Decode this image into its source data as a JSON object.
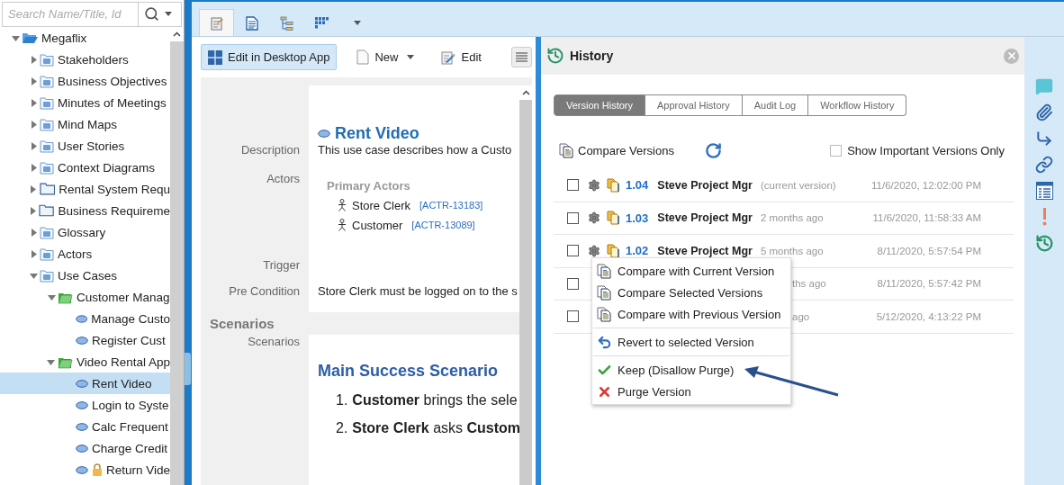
{
  "search": {
    "placeholder": "Search Name/Title, Id"
  },
  "tree": [
    {
      "label": "Megaflix",
      "kind": "root",
      "expanded": true,
      "selected": false,
      "locked": false,
      "children": [
        {
          "label": "Stakeholders",
          "kind": "module",
          "expanded": false,
          "selected": false,
          "locked": false
        },
        {
          "label": "Business Objectives",
          "kind": "module",
          "expanded": false,
          "selected": false,
          "locked": false
        },
        {
          "label": "Minutes of Meetings",
          "kind": "module",
          "expanded": false,
          "selected": false,
          "locked": false
        },
        {
          "label": "Mind Maps",
          "kind": "module",
          "expanded": false,
          "selected": false,
          "locked": false
        },
        {
          "label": "User Stories",
          "kind": "module",
          "expanded": false,
          "selected": false,
          "locked": false
        },
        {
          "label": "Context Diagrams",
          "kind": "module",
          "expanded": false,
          "selected": false,
          "locked": false
        },
        {
          "label": "Rental System Requ",
          "kind": "folder",
          "expanded": false,
          "selected": false,
          "locked": false
        },
        {
          "label": "Business Requireme",
          "kind": "folder",
          "expanded": false,
          "selected": false,
          "locked": false
        },
        {
          "label": "Glossary",
          "kind": "module",
          "expanded": false,
          "selected": false,
          "locked": false
        },
        {
          "label": "Actors",
          "kind": "module",
          "expanded": false,
          "selected": false,
          "locked": false
        },
        {
          "label": "Use Cases",
          "kind": "module",
          "expanded": true,
          "selected": false,
          "locked": false,
          "children": [
            {
              "label": "Customer Manag",
              "kind": "group",
              "expanded": true,
              "selected": false,
              "locked": false,
              "children": [
                {
                  "label": "Manage Custo",
                  "kind": "use-case",
                  "selected": false,
                  "locked": false
                },
                {
                  "label": "Register Cust",
                  "kind": "use-case",
                  "selected": false,
                  "locked": false
                }
              ]
            },
            {
              "label": "Video Rental App",
              "kind": "group",
              "expanded": true,
              "selected": false,
              "locked": false,
              "children": [
                {
                  "label": "Rent Video",
                  "kind": "use-case",
                  "selected": true,
                  "locked": false
                },
                {
                  "label": "Login to Syste",
                  "kind": "use-case",
                  "selected": false,
                  "locked": false
                },
                {
                  "label": "Calc Frequent",
                  "kind": "use-case",
                  "selected": false,
                  "locked": false
                },
                {
                  "label": "Charge Credit",
                  "kind": "use-case",
                  "selected": false,
                  "locked": false
                },
                {
                  "label": "Return Vide",
                  "kind": "use-case",
                  "selected": false,
                  "locked": true
                }
              ]
            }
          ]
        }
      ]
    }
  ],
  "view_tabs": [
    {
      "kind": "details",
      "selected": true
    },
    {
      "kind": "document",
      "selected": false
    },
    {
      "kind": "tree",
      "selected": false
    },
    {
      "kind": "grid",
      "selected": false
    }
  ],
  "toolbar": [
    {
      "label": "Edit in Desktop App",
      "kind": "desktop",
      "selected": true
    },
    {
      "label": "New",
      "kind": "new",
      "selected": false
    },
    {
      "label": "Edit",
      "kind": "edit",
      "selected": false
    }
  ],
  "item": {
    "title": "Rent Video",
    "fields": [
      {
        "label": "Description",
        "kind": "text",
        "value": "This use case describes how a Custo"
      },
      {
        "label": "Actors",
        "kind": "actors",
        "heading": "Primary Actors",
        "actors": [
          {
            "name": "Store Clerk",
            "id": "[ACTR-13183]"
          },
          {
            "name": "Customer",
            "id": "[ACTR-13089]"
          }
        ]
      },
      {
        "label": "Trigger",
        "kind": "empty"
      },
      {
        "label": "Pre Condition",
        "kind": "text",
        "value": "Store Clerk must be logged on to the s"
      }
    ],
    "section": "Scenarios",
    "scenarios": {
      "label": "Scenarios",
      "heading": "Main Success Scenario",
      "steps": [
        {
          "number": "1.",
          "text": "**Customer** brings the sele"
        },
        {
          "number": "2.",
          "text": "**Store Clerk** asks **Custom**"
        }
      ]
    }
  },
  "history": {
    "title": "History",
    "tabs": [
      {
        "label": "Version History",
        "selected": true
      },
      {
        "label": "Approval History",
        "selected": false
      },
      {
        "label": "Audit Log",
        "selected": false
      },
      {
        "label": "Workflow History",
        "selected": false
      }
    ],
    "compare_label": "Compare Versions",
    "important_only": {
      "label": "Show Important Versions Only",
      "checked": false
    },
    "versions": [
      {
        "covered": false,
        "checked": false,
        "version": "1.04",
        "author": "Steve Project Mgr",
        "note": "(current version)",
        "date": "11/6/2020, 12:02:00 PM"
      },
      {
        "covered": false,
        "checked": false,
        "version": "1.03",
        "author": "Steve Project Mgr",
        "note": "2 months ago",
        "date": "11/6/2020, 11:58:33 AM"
      },
      {
        "covered": false,
        "checked": false,
        "version": "1.02",
        "author": "Steve Project Mgr",
        "note": "5 months ago",
        "date": "8/11/2020, 5:57:54 PM"
      },
      {
        "covered": true,
        "checked": false,
        "note": "ths ago",
        "date": "8/11/2020, 5:57:42 PM"
      },
      {
        "covered": true,
        "checked": false,
        "note": "ago",
        "date": "5/12/2020, 4:13:22 PM"
      }
    ]
  },
  "context_menu": [
    {
      "kind": "compare",
      "label": "Compare with Current Version"
    },
    {
      "kind": "compare",
      "label": "Compare Selected Versions"
    },
    {
      "kind": "compare",
      "label": "Compare with Previous Version"
    },
    {
      "kind": "separator"
    },
    {
      "kind": "revert",
      "label": "Revert to selected Version"
    },
    {
      "kind": "separator"
    },
    {
      "kind": "keep",
      "label": "Keep (Disallow Purge)"
    },
    {
      "kind": "purge",
      "label": "Purge Version"
    }
  ]
}
